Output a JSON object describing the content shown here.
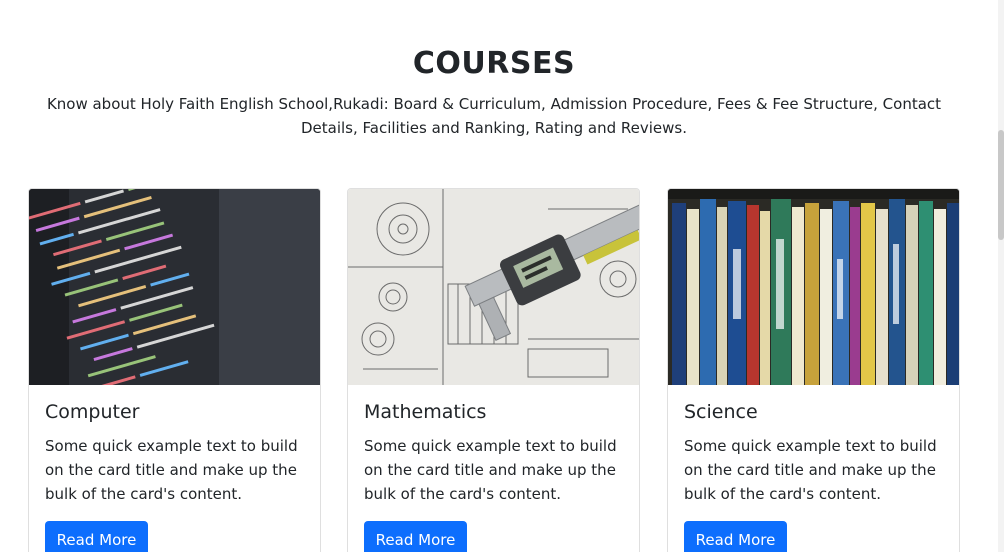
{
  "section": {
    "title": "COURSES",
    "description": "Know about Holy Faith English School,Rukadi: Board & Curriculum, Admission Procedure, Fees & Fee Structure, Contact Details, Facilities and Ranking, Rating and Reviews."
  },
  "cards": [
    {
      "title": "Computer",
      "text": "Some quick example text to build on the card title and make up the bulk of the card's content.",
      "button": "Read More",
      "image": "code-editor-photo"
    },
    {
      "title": "Mathematics",
      "text": "Some quick example text to build on the card title and make up the bulk of the card's content.",
      "button": "Read More",
      "image": "caliper-blueprint-photo"
    },
    {
      "title": "Science",
      "text": "Some quick example text to build on the card title and make up the bulk of the card's content.",
      "button": "Read More",
      "image": "bookshelf-photo"
    }
  ],
  "colors": {
    "button": "#0d6efd",
    "text": "#212529"
  }
}
